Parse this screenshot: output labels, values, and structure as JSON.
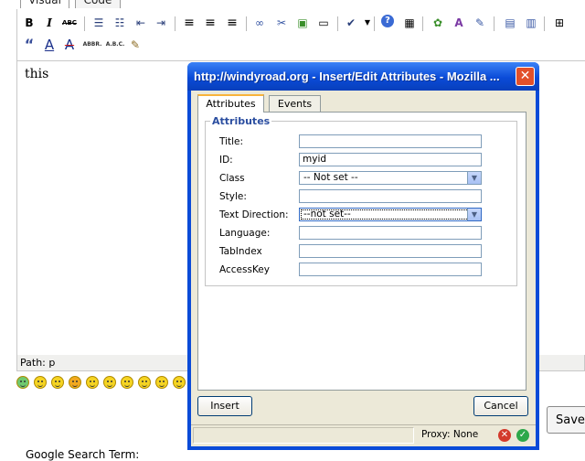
{
  "editor_tabs": [
    "Visual",
    "Code"
  ],
  "toolbar": {
    "row1": [
      {
        "icon": "bold-icon",
        "glyph": "B"
      },
      {
        "icon": "italic-icon",
        "glyph": "I"
      },
      {
        "icon": "strikethrough-icon",
        "glyph": "ABC"
      },
      {
        "icon": "bulleted-list-icon",
        "glyph": "☰"
      },
      {
        "icon": "numbered-list-icon",
        "glyph": "☷"
      },
      {
        "icon": "outdent-icon",
        "glyph": "⇤"
      },
      {
        "icon": "indent-icon",
        "glyph": "⇥"
      },
      {
        "icon": "align-left-icon",
        "glyph": "≡"
      },
      {
        "icon": "align-center-icon",
        "glyph": "≡"
      },
      {
        "icon": "align-right-icon",
        "glyph": "≡"
      },
      {
        "icon": "link-icon",
        "glyph": "∞"
      },
      {
        "icon": "unlink-icon",
        "glyph": "✂"
      },
      {
        "icon": "image-icon",
        "glyph": "▣"
      },
      {
        "icon": "page-break-icon",
        "glyph": "▭"
      },
      {
        "icon": "spellcheck-icon",
        "glyph": "✔"
      },
      {
        "icon": "help-icon",
        "glyph": "?"
      },
      {
        "icon": "table-icon",
        "glyph": "▦"
      },
      {
        "icon": "insert-graphic-icon",
        "glyph": "✿"
      },
      {
        "icon": "font-color-icon",
        "glyph": "A"
      },
      {
        "icon": "edit-icon",
        "glyph": "✎"
      },
      {
        "icon": "cell-props-icon",
        "glyph": "▤"
      },
      {
        "icon": "row-props-icon",
        "glyph": "▥"
      },
      {
        "icon": "insert-row-icon",
        "glyph": "⊞"
      }
    ],
    "row2": [
      {
        "icon": "blockquote-icon",
        "glyph": "“"
      },
      {
        "icon": "text-color-icon",
        "glyph": "A"
      },
      {
        "icon": "remove-format-icon",
        "glyph": "A"
      },
      {
        "icon": "abbreviation-icon",
        "glyph": "ABBR."
      },
      {
        "icon": "acronym-icon",
        "glyph": "A.B.C."
      },
      {
        "icon": "attributes-icon",
        "glyph": "✎"
      }
    ]
  },
  "editor": {
    "content": "this",
    "path": "Path: p"
  },
  "save_button": "Save",
  "google_label": "Google Search Term:",
  "dialog": {
    "title": "http://windyroad.org - Insert/Edit Attributes - Mozilla ...",
    "tabs": [
      "Attributes",
      "Events"
    ],
    "legend": "Attributes",
    "fields": {
      "title": {
        "label": "Title:",
        "value": ""
      },
      "id": {
        "label": "ID:",
        "value": "myid"
      },
      "class": {
        "label": "Class",
        "value": "-- Not set --"
      },
      "style": {
        "label": "Style:",
        "value": ""
      },
      "text_direction": {
        "label": "Text Direction:",
        "value": "--not set--"
      },
      "language": {
        "label": "Language:",
        "value": ""
      },
      "tabindex": {
        "label": "TabIndex",
        "value": ""
      },
      "accesskey": {
        "label": "AccessKey",
        "value": ""
      }
    },
    "insert_label": "Insert",
    "cancel_label": "Cancel",
    "status": {
      "proxy": "Proxy: None"
    }
  },
  "colors": {
    "titlebar": "#0a4bd8",
    "dialog_bg": "#ece9d8",
    "legend": "#2b4ea0"
  }
}
